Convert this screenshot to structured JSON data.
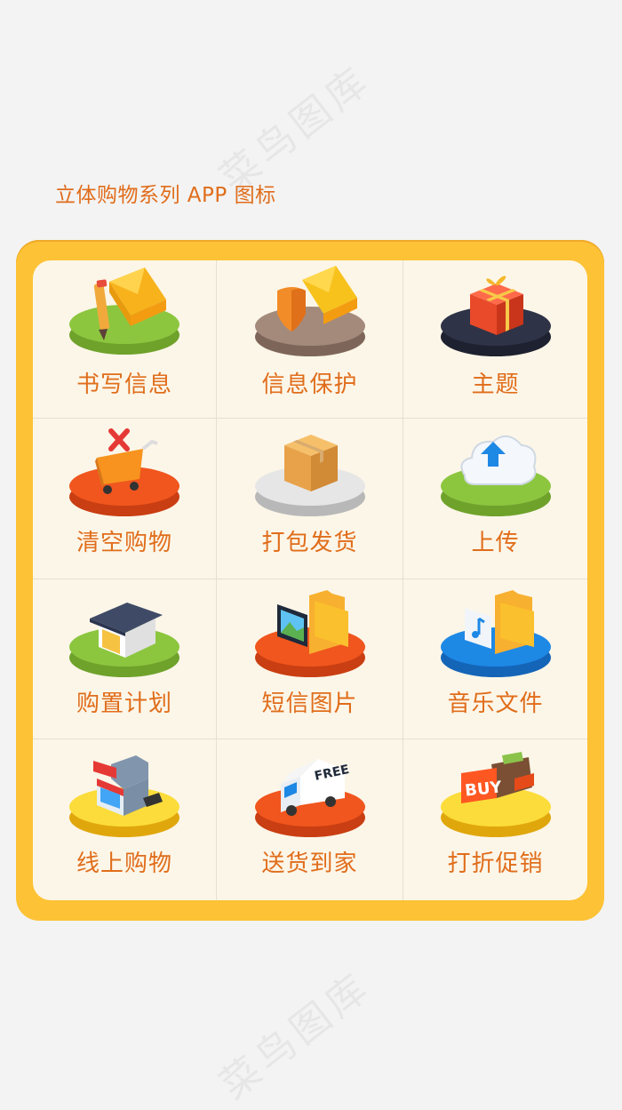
{
  "header": {
    "title": "立体购物系列 APP 图标"
  },
  "watermark": {
    "text": "菜鸟图库"
  },
  "colors": {
    "accent": "#e06d1b",
    "frame": "#fdc235",
    "panel": "#fcf6e8"
  },
  "icons": [
    {
      "label": "书写信息",
      "icon": "letter-pencil-icon",
      "base": "#8cc63f"
    },
    {
      "label": "信息保护",
      "icon": "envelope-shield-icon",
      "base": "#a48a7b"
    },
    {
      "label": "主题",
      "icon": "gift-box-icon",
      "base": "#2f3347"
    },
    {
      "label": "清空购物",
      "icon": "empty-cart-icon",
      "base": "#f0561e"
    },
    {
      "label": "打包发货",
      "icon": "package-box-icon",
      "base": "#dcdcdc"
    },
    {
      "label": "上传",
      "icon": "cloud-upload-icon",
      "base": "#8cc63f"
    },
    {
      "label": "购置计划",
      "icon": "house-icon",
      "base": "#8cc63f"
    },
    {
      "label": "短信图片",
      "icon": "folder-image-icon",
      "base": "#f0561e"
    },
    {
      "label": "音乐文件",
      "icon": "folder-music-icon",
      "base": "#1e88e5"
    },
    {
      "label": "线上购物",
      "icon": "store-icon",
      "base": "#fbc02d"
    },
    {
      "label": "送货到家",
      "icon": "delivery-van-icon",
      "base": "#f0561e",
      "badge": "FREE"
    },
    {
      "label": "打折促销",
      "icon": "buy-wallet-icon",
      "base": "#fbc02d",
      "badge": "BUY"
    }
  ]
}
